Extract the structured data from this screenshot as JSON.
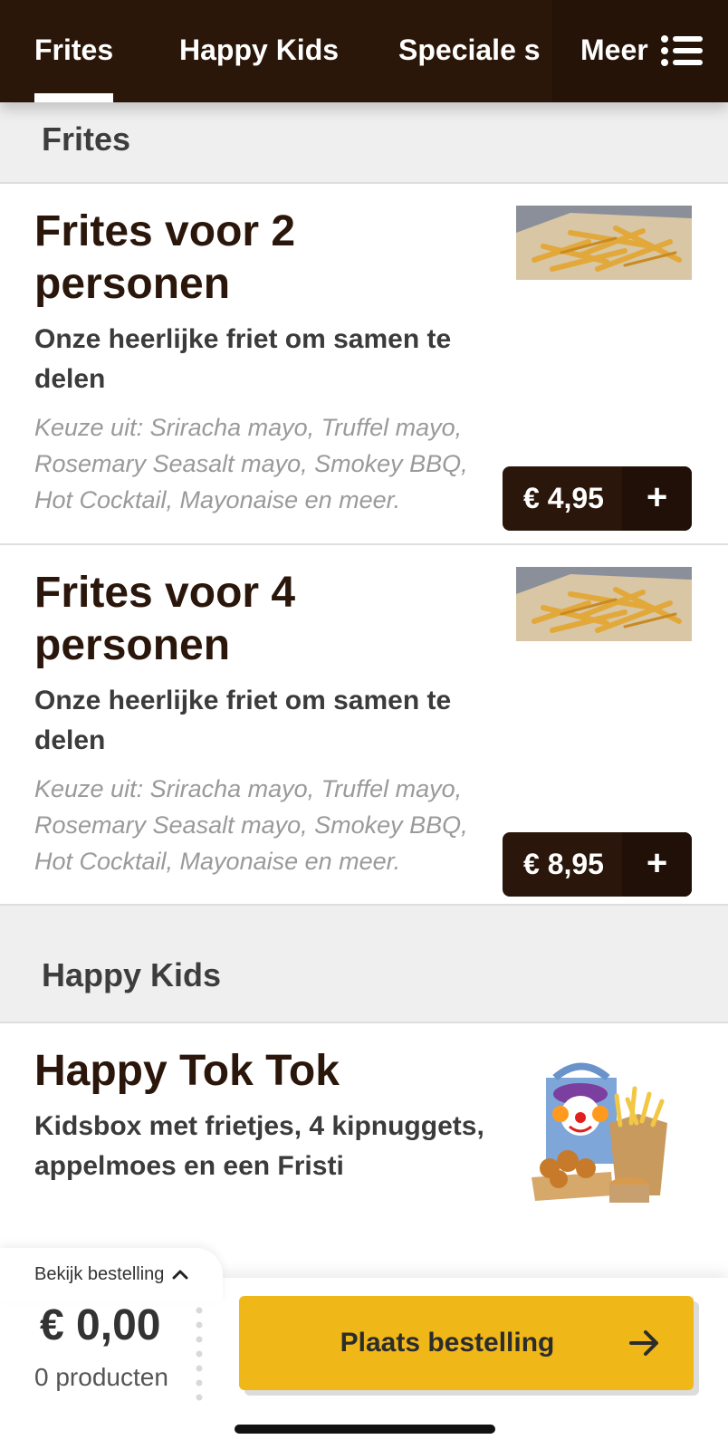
{
  "nav": {
    "tabs": [
      {
        "label": "Frites",
        "active": true
      },
      {
        "label": "Happy Kids",
        "active": false
      },
      {
        "label": "Speciale sa",
        "active": false
      }
    ],
    "more_label": "Meer"
  },
  "sections": [
    {
      "title": "Frites",
      "products": [
        {
          "name": "Frites voor 2 personen",
          "description": "Onze heerlijke friet om samen te delen",
          "note": "Keuze uit: Sriracha mayo, Truffel mayo, Rosemary Seasalt mayo, Smokey BBQ, Hot Cocktail, Mayonaise en meer.",
          "price": "€ 4,95",
          "add_symbol": "+"
        },
        {
          "name": "Frites voor 4 personen",
          "description": "Onze heerlijke friet om samen te delen",
          "note": "Keuze uit: Sriracha mayo, Truffel mayo, Rosemary Seasalt mayo, Smokey BBQ, Hot Cocktail, Mayonaise en meer.",
          "price": "€ 8,95",
          "add_symbol": "+"
        }
      ]
    },
    {
      "title": "Happy Kids",
      "products": [
        {
          "name": "Happy Tok Tok",
          "description": "Kidsbox met frietjes, 4 kipnuggets, appelmoes en een Fristi"
        }
      ]
    }
  ],
  "order_bar": {
    "view_order_label": "Bekijk bestelling",
    "total": "€ 0,00",
    "count": "0 producten",
    "place_order_label": "Plaats bestelling"
  },
  "colors": {
    "brand_dark": "#2b170a",
    "accent_yellow": "#f0b719"
  }
}
